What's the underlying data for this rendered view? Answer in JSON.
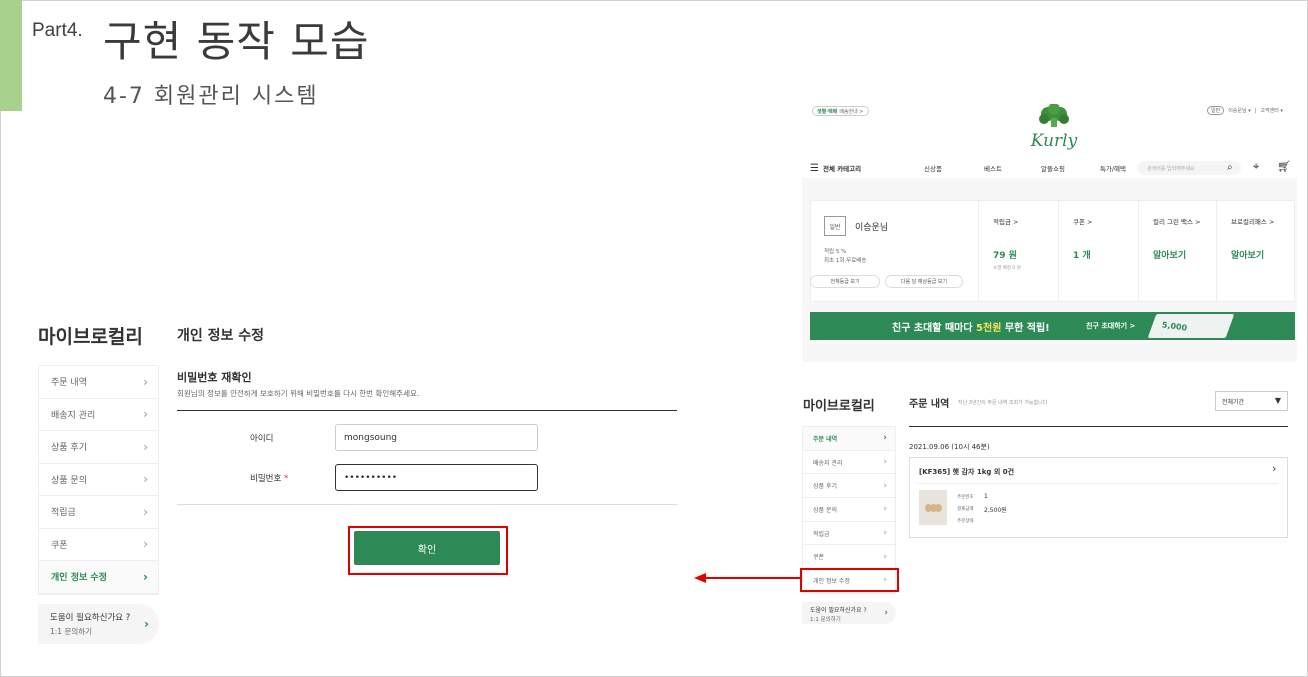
{
  "slide": {
    "part": "Part4.",
    "title": "구현 동작 모습",
    "subtitle": "4-7 회원관리 시스템"
  },
  "colors": {
    "kurly_green": "#2d8a57",
    "accent": "#a9d18e",
    "highlight": "#e00000"
  },
  "left_screen": {
    "sidebar_title": "마이브로컬리",
    "sidebar_items": [
      {
        "label": "주문 내역"
      },
      {
        "label": "배송지 관리"
      },
      {
        "label": "상품 후기"
      },
      {
        "label": "상품 문의"
      },
      {
        "label": "적립금"
      },
      {
        "label": "쿠폰"
      },
      {
        "label": "개인 정보 수정",
        "active": true
      }
    ],
    "help": {
      "title": "도움이 필요하신가요 ?",
      "sub": "1:1 문의하기"
    },
    "page_title": "개인 정보 수정",
    "section_title": "비밀번호 재확인",
    "section_desc": "회원님의 정보를 안전하게 보호하기 위해 비밀번호를 다시 한번 확인해주세요.",
    "id_label": "아이디",
    "id_value": "mongsoung",
    "pw_label": "비밀번호",
    "pw_required": "*",
    "pw_value": "••••••••••",
    "confirm_label": "확인"
  },
  "right_screen": {
    "delivery_badge_green": "샛별·택배",
    "delivery_badge_text": "배송안내 >",
    "top_links": {
      "logout": "일반",
      "user": "이승운님 ▾",
      "sep": "|",
      "service": "고객센터 ▾"
    },
    "logo": "Kurly",
    "gnb": {
      "all_category": "전체 카테고리",
      "menus": [
        "신상품",
        "베스트",
        "알뜰쇼핑",
        "특가/혜택"
      ],
      "search_placeholder": "검색어를 입력해주세요"
    },
    "member": {
      "grade": "일반",
      "name": "이승운님",
      "benefit1": "적립 5 %",
      "benefit2": "최초 1회 무료배송",
      "btn_all_grade": "전체등급 보기",
      "btn_next_grade": "다음 달 예상등급 보기",
      "columns": [
        {
          "title": "적립금 >",
          "value": "79 원",
          "note": "소멸 예정 0 원"
        },
        {
          "title": "쿠폰 >",
          "value": "1 개",
          "note": ""
        },
        {
          "title": "컬리 그린 백스 >",
          "value": "알아보기",
          "note": ""
        },
        {
          "title": "브로컬리패스 >",
          "value": "알아보기",
          "note": ""
        }
      ]
    },
    "banner": {
      "text_a": "친구 초대할 때마다 ",
      "text_hl": "5천원",
      "text_b": " 무한 적립!",
      "cta": "친구 초대하기 >",
      "ticket": "5,000"
    },
    "sidebar_title": "마이브로컬리",
    "sidebar_items": [
      {
        "label": "주문 내역",
        "active": true
      },
      {
        "label": "배송지 관리"
      },
      {
        "label": "상품 후기"
      },
      {
        "label": "상품 문의"
      },
      {
        "label": "적립금"
      },
      {
        "label": "쿠폰"
      },
      {
        "label": "개인 정보 수정"
      }
    ],
    "help": {
      "title": "도움이 필요하신가요 ?",
      "sub": "1:1 문의하기"
    },
    "orders_title": "주문 내역",
    "orders_desc": "지난 3년간의 주문 내역 조회가 가능합니다",
    "period": "전체기간",
    "order": {
      "date": "2021.09.06 (10시 46분)",
      "name": "[KF365] 햇 감자 1kg 외 0건",
      "label_no": "주문번호",
      "value_no": "1",
      "label_amount": "결제금액",
      "value_amount": "2,500원",
      "label_status": "주문상태"
    }
  }
}
